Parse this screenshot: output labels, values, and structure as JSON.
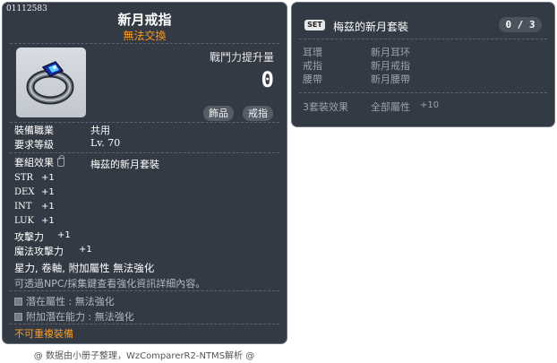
{
  "item": {
    "id": "01112583",
    "name": "新月戒指",
    "trade_status": "無法交換",
    "power_label": "戰鬥力提升量",
    "power_value": "0",
    "tags": [
      "飾品",
      "戒指"
    ],
    "job_label": "裝備職業",
    "job_value": "共用",
    "level_label": "要求等級",
    "level_value": "Lv. 70",
    "set_label": "套組效果",
    "set_value": "梅茲的新月套裝",
    "stats": [
      {
        "name": "STR",
        "value": "+1"
      },
      {
        "name": "DEX",
        "value": "+1"
      },
      {
        "name": "INT",
        "value": "+1"
      },
      {
        "name": "LUK",
        "value": "+1"
      },
      {
        "name": "攻擊力",
        "value": "+1"
      },
      {
        "name": "魔法攻擊力",
        "value": "+1"
      }
    ],
    "enhance_line": "星力, 卷軸, 附加屬性 無法強化",
    "npc_hint": "可透過NPC/採集鍵查看強化資訊詳細內容。",
    "potential_label": "潛在屬性 : 無法強化",
    "bonus_potential_label": "附加潛在能力 : 無法強化",
    "unique_equip": "不可重複裝備"
  },
  "set_panel": {
    "badge": "SET",
    "name": "梅茲的新月套裝",
    "progress": "0 / 3",
    "slots": [
      {
        "slot": "耳環",
        "item": "新月耳环"
      },
      {
        "slot": "戒指",
        "item": "新月戒指"
      },
      {
        "slot": "腰帶",
        "item": "新月腰帶"
      }
    ],
    "effect_label": "3套裝效果",
    "effect_value": "全部屬性",
    "effect_bonus": "+10"
  },
  "footer": "@ 数据由小册子整理，WzComparerR2-NTMS解析 @",
  "colors": {
    "panel_bg": "#333a44",
    "accent_orange": "#ff9a1c",
    "muted_text": "#9aa2ad"
  }
}
